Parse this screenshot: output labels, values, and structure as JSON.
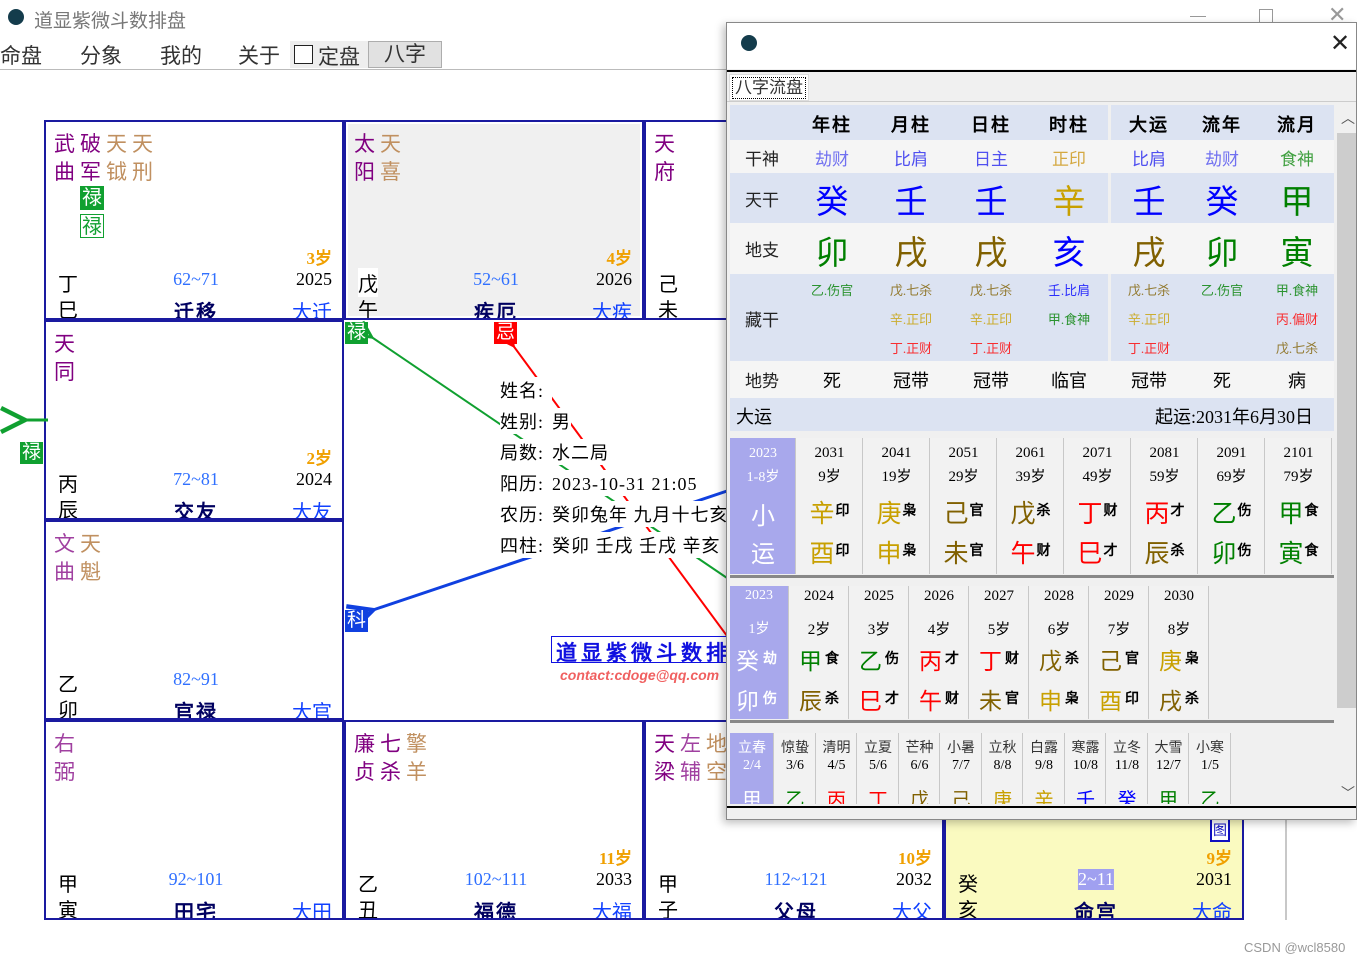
{
  "app": {
    "title": "道显紫微斗数排盘",
    "menu": [
      "命盘",
      "分象",
      "我的",
      "关于"
    ],
    "checkbox_label": "定盘",
    "checkbox_checked": false,
    "bazi_button": "八字",
    "watermark": "CSDN @wcl8580"
  },
  "colors": {
    "grid": "#1a1aa0",
    "main_star": "#800080",
    "aux_star": "#a040a0",
    "minor_star": "#c09060",
    "age": "#f0a000",
    "range": "#3070ff",
    "palace_name": "#000060",
    "da_palace": "#1040ff",
    "lu": "#10a030",
    "ji": "#ff0000",
    "ke": "#1040e0",
    "ming_bg": "#fafac0",
    "highlight": "#a0a0f0"
  },
  "element_colors": {
    "wood": "#008000",
    "fire": "#ff0000",
    "earth": "#806000",
    "metal": "#c8a000",
    "water": "#0000ff"
  },
  "palaces": [
    {
      "branch_key": "si",
      "stars": [
        {
          "n": "武曲",
          "t": "main"
        },
        {
          "n": "破军",
          "t": "main"
        },
        {
          "n": "天钺",
          "t": "minor"
        },
        {
          "n": "天刑",
          "t": "minor"
        }
      ],
      "hua": [
        {
          "label": "禄",
          "style": "solid",
          "star": 1
        },
        {
          "label": "禄",
          "style": "outline",
          "star": 1
        }
      ],
      "age": "3岁",
      "stem": "丁",
      "branch": "巳",
      "range": "62~71",
      "year": "2025",
      "name": "迁移",
      "da": "大迁"
    },
    {
      "branch_key": "wu",
      "stars": [
        {
          "n": "太阳",
          "t": "main"
        },
        {
          "n": "天喜",
          "t": "minor"
        }
      ],
      "age": "4岁",
      "stem": "戊",
      "branch": "午",
      "range": "52~61",
      "year": "2026",
      "name": "疾厄",
      "da": "大疾",
      "shaded": true
    },
    {
      "branch_key": "wei",
      "stars": [
        {
          "n": "天府",
          "t": "main"
        }
      ],
      "stem": "己",
      "branch": "未"
    },
    {
      "branch_key": "chen",
      "stars": [
        {
          "n": "天同",
          "t": "main"
        }
      ],
      "age": "2岁",
      "stem": "丙",
      "branch": "辰",
      "range": "72~81",
      "year": "2024",
      "name": "交友",
      "da": "大友"
    },
    {
      "branch_key": "mao",
      "stars": [
        {
          "n": "文曲",
          "t": "aux"
        },
        {
          "n": "天魁",
          "t": "minor"
        }
      ],
      "stem": "乙",
      "branch": "卯",
      "range": "82~91",
      "name": "官禄",
      "da": "大官"
    },
    {
      "branch_key": "yin",
      "stars": [
        {
          "n": "右弼",
          "t": "aux"
        }
      ],
      "stem": "甲",
      "branch": "寅",
      "range": "92~101",
      "name": "田宅",
      "da": "大田"
    },
    {
      "branch_key": "chou",
      "stars": [
        {
          "n": "廉贞",
          "t": "main"
        },
        {
          "n": "七杀",
          "t": "main"
        },
        {
          "n": "擎羊",
          "t": "minor"
        }
      ],
      "age": "11岁",
      "stem": "乙",
      "branch": "丑",
      "range": "102~111",
      "year": "2033",
      "name": "福德",
      "da": "大福"
    },
    {
      "branch_key": "zi",
      "stars": [
        {
          "n": "天梁",
          "t": "main"
        },
        {
          "n": "左辅",
          "t": "aux"
        },
        {
          "n": "地空",
          "t": "minor"
        }
      ],
      "age": "10岁",
      "stem": "甲",
      "branch": "子",
      "range": "112~121",
      "year": "2032",
      "name": "父母",
      "da": "大父"
    },
    {
      "branch_key": "hai",
      "age": "9岁",
      "stem": "癸",
      "branch": "亥",
      "range": "2~11",
      "year": "2031",
      "name": "命宫",
      "da": "大命",
      "ming": true,
      "icon_label": "图"
    }
  ],
  "center": {
    "info": [
      {
        "label": "姓名:",
        "value": ""
      },
      {
        "label": "姓别:",
        "value": "男"
      },
      {
        "label": "局数:",
        "value": "水二局"
      },
      {
        "label": "阳历:",
        "value": "2023-10-31 21:05"
      },
      {
        "label": "农历:",
        "value": "癸卯兔年 九月十七亥"
      },
      {
        "label": "四柱:",
        "value": "癸卯  壬戌  壬戌  辛亥"
      }
    ],
    "marks": {
      "lu": "禄",
      "ji": "忌",
      "ke": "科",
      "outer_lu": "禄"
    },
    "banner": "道显紫微斗数排盘",
    "contact": "contact:cdoge@qq.com"
  },
  "popup": {
    "tab": "八字流盘",
    "headers": [
      "年柱",
      "月柱",
      "日柱",
      "时柱",
      "大运",
      "流年",
      "流月"
    ],
    "row_labels": {
      "shishen": "干神",
      "tiangan": "天干",
      "dizhi": "地支",
      "canggan": "藏干",
      "dishi": "地势"
    },
    "shishen": [
      "劫财",
      "比肩",
      "日主",
      "正印",
      "比肩",
      "劫财",
      "食神"
    ],
    "tiangan": [
      "癸",
      "壬",
      "壬",
      "辛",
      "壬",
      "癸",
      "甲"
    ],
    "dizhi": [
      "卯",
      "戌",
      "戌",
      "亥",
      "戌",
      "卯",
      "寅"
    ],
    "canggan": [
      [
        "乙.伤官"
      ],
      [
        "戊.七杀",
        "辛.正印",
        "丁.正财"
      ],
      [
        "戊.七杀",
        "辛.正印",
        "丁.正财"
      ],
      [
        "壬.比肩",
        "甲.食神"
      ],
      [
        "戊.七杀",
        "辛.正印",
        "丁.正财"
      ],
      [
        "乙.伤官"
      ],
      [
        "甲.食神",
        "丙.偏财",
        "戊.七杀"
      ]
    ],
    "dishi": [
      "死",
      "冠带",
      "冠带",
      "临官",
      "冠带",
      "死",
      "病"
    ],
    "dayun_label": "大运",
    "qiyun": "起运:2031年6月30日",
    "dayun_first": {
      "year": "2023",
      "age": "1-8岁",
      "l1": "小",
      "l2": "运"
    },
    "dayun": [
      [
        "2031",
        "9岁",
        "辛",
        "印",
        "酉",
        "印"
      ],
      [
        "2041",
        "19岁",
        "庚",
        "枭",
        "申",
        "枭"
      ],
      [
        "2051",
        "29岁",
        "己",
        "官",
        "未",
        "官"
      ],
      [
        "2061",
        "39岁",
        "戊",
        "杀",
        "午",
        "财"
      ],
      [
        "2071",
        "49岁",
        "丁",
        "财",
        "巳",
        "才"
      ],
      [
        "2081",
        "59岁",
        "丙",
        "才",
        "辰",
        "杀"
      ],
      [
        "2091",
        "69岁",
        "乙",
        "伤",
        "卯",
        "伤"
      ],
      [
        "2101",
        "79岁",
        "甲",
        "食",
        "寅",
        "食"
      ]
    ],
    "liunian_first": {
      "year": "2023",
      "age": "1岁",
      "stem": "癸",
      "stem_ss": "劫",
      "branch": "卯",
      "branch_ss": "伤"
    },
    "liunian": [
      [
        "2024",
        "2岁",
        "甲",
        "食",
        "辰",
        "杀"
      ],
      [
        "2025",
        "3岁",
        "乙",
        "伤",
        "巳",
        "才"
      ],
      [
        "2026",
        "4岁",
        "丙",
        "才",
        "午",
        "财"
      ],
      [
        "2027",
        "5岁",
        "丁",
        "财",
        "未",
        "官"
      ],
      [
        "2028",
        "6岁",
        "戊",
        "杀",
        "申",
        "枭"
      ],
      [
        "2029",
        "7岁",
        "己",
        "官",
        "酉",
        "印"
      ],
      [
        "2030",
        "8岁",
        "庚",
        "枭",
        "戌",
        "杀"
      ]
    ],
    "liuyue_first": {
      "term": "立春",
      "date": "2/4",
      "stem": "甲"
    },
    "liuyue": [
      [
        "惊蛰",
        "3/6",
        "乙"
      ],
      [
        "清明",
        "4/5",
        "丙"
      ],
      [
        "立夏",
        "5/6",
        "丁"
      ],
      [
        "芒种",
        "6/6",
        "戊"
      ],
      [
        "小暑",
        "7/7",
        "己"
      ],
      [
        "立秋",
        "8/8",
        "庚"
      ],
      [
        "白露",
        "9/8",
        "辛"
      ],
      [
        "寒露",
        "10/8",
        "壬"
      ],
      [
        "立冬",
        "11/8",
        "癸"
      ],
      [
        "大雪",
        "12/7",
        "甲"
      ],
      [
        "小寒",
        "1/5",
        "乙"
      ]
    ],
    "shishen_colors": {
      "劫财": "#7070f0",
      "比肩": "#5050f0",
      "日主": "#5050f0",
      "正印": "#d4a840",
      "食神": "#40a040"
    }
  }
}
